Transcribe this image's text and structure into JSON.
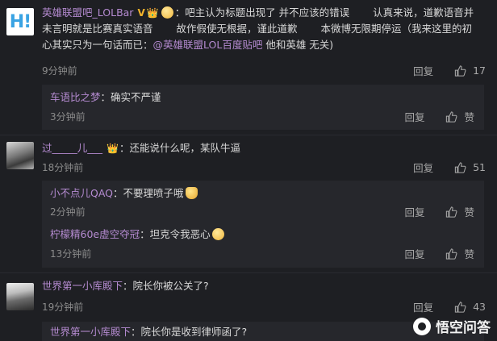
{
  "thumb_icon": "thumbs-up-icon",
  "comments": [
    {
      "avatar": "H!",
      "user": "英雄联盟吧_LOLBar",
      "badges": [
        "V",
        "👑"
      ],
      "text_line1": "：吧主认为标题出现了 并不应该的错误 　　认真来说，道歉语音并",
      "text_line2": "未言明就是比赛真实语音 　　故作假使无根据，谨此道歉 　　本微博无限期停运（我来这里的初",
      "text_line3": "心其实只为一句话而已：",
      "mention": "@英雄联盟LOL百度贴吧",
      "text_tail": " 他和英雄 无关)",
      "time": "9分钟前",
      "reply_label": "回复",
      "likes": "17",
      "replies": [
        {
          "user": "车语比之梦",
          "text": "：确实不严谨",
          "time": "3分钟前",
          "reply_label": "回复",
          "like_label": "赞"
        }
      ]
    },
    {
      "user": "过_____儿___",
      "badges": [
        "👑"
      ],
      "text": "：还能说什么呢，某队牛逼",
      "time": "18分钟前",
      "reply_label": "回复",
      "likes": "51",
      "replies": [
        {
          "user": "小不点儿QAQ",
          "text": "：不要理喷子哦",
          "time": "2分钟前",
          "reply_label": "回复",
          "like_label": "赞"
        },
        {
          "user": "柠檬精60e虚空夺冠",
          "text": "：坦克令我恶心",
          "time": "13分钟前",
          "reply_label": "回复",
          "like_label": "赞"
        }
      ]
    },
    {
      "user": "世界第一小库殿下",
      "text": "：院长你被公关了?",
      "time": "19分钟前",
      "reply_label": "回复",
      "likes": "43",
      "replies": [
        {
          "user": "世界第一小库殿下",
          "text": "：院长你是收到律师函了?"
        }
      ]
    }
  ],
  "watermark": "悟空问答"
}
